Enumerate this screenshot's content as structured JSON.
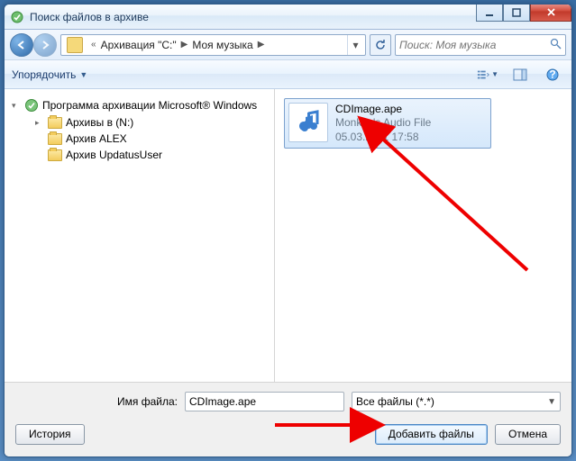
{
  "window": {
    "title": "Поиск файлов в архиве"
  },
  "address": {
    "double_chevron": "«",
    "part1": "Архивация \"C:\"",
    "part2": "Моя музыка"
  },
  "search": {
    "placeholder": "Поиск: Моя музыка"
  },
  "toolbar": {
    "organize": "Упорядочить"
  },
  "navpane": {
    "root": "Программа архивации Microsoft® Windows",
    "items": [
      "Архивы в (N:)",
      "Архив ALEX",
      "Архив UpdatusUser"
    ]
  },
  "file": {
    "name": "CDImage.ape",
    "desc": "Monkey's Audio File",
    "date": "05.03.2011 17:58"
  },
  "bottom": {
    "filename_label": "Имя файла:",
    "filename_value": "CDImage.ape",
    "filter": "Все файлы (*.*)",
    "history": "История",
    "add": "Добавить файлы",
    "cancel": "Отмена"
  }
}
